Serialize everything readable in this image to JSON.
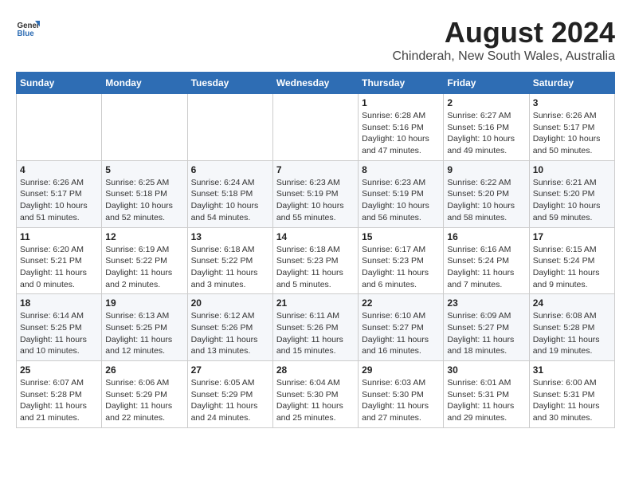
{
  "header": {
    "logo_general": "General",
    "logo_blue": "Blue",
    "title": "August 2024",
    "subtitle": "Chinderah, New South Wales, Australia"
  },
  "calendar": {
    "columns": [
      "Sunday",
      "Monday",
      "Tuesday",
      "Wednesday",
      "Thursday",
      "Friday",
      "Saturday"
    ],
    "weeks": [
      [
        {
          "day": "",
          "info": ""
        },
        {
          "day": "",
          "info": ""
        },
        {
          "day": "",
          "info": ""
        },
        {
          "day": "",
          "info": ""
        },
        {
          "day": "1",
          "info": "Sunrise: 6:28 AM\nSunset: 5:16 PM\nDaylight: 10 hours and 47 minutes."
        },
        {
          "day": "2",
          "info": "Sunrise: 6:27 AM\nSunset: 5:16 PM\nDaylight: 10 hours and 49 minutes."
        },
        {
          "day": "3",
          "info": "Sunrise: 6:26 AM\nSunset: 5:17 PM\nDaylight: 10 hours and 50 minutes."
        }
      ],
      [
        {
          "day": "4",
          "info": "Sunrise: 6:26 AM\nSunset: 5:17 PM\nDaylight: 10 hours and 51 minutes."
        },
        {
          "day": "5",
          "info": "Sunrise: 6:25 AM\nSunset: 5:18 PM\nDaylight: 10 hours and 52 minutes."
        },
        {
          "day": "6",
          "info": "Sunrise: 6:24 AM\nSunset: 5:18 PM\nDaylight: 10 hours and 54 minutes."
        },
        {
          "day": "7",
          "info": "Sunrise: 6:23 AM\nSunset: 5:19 PM\nDaylight: 10 hours and 55 minutes."
        },
        {
          "day": "8",
          "info": "Sunrise: 6:23 AM\nSunset: 5:19 PM\nDaylight: 10 hours and 56 minutes."
        },
        {
          "day": "9",
          "info": "Sunrise: 6:22 AM\nSunset: 5:20 PM\nDaylight: 10 hours and 58 minutes."
        },
        {
          "day": "10",
          "info": "Sunrise: 6:21 AM\nSunset: 5:20 PM\nDaylight: 10 hours and 59 minutes."
        }
      ],
      [
        {
          "day": "11",
          "info": "Sunrise: 6:20 AM\nSunset: 5:21 PM\nDaylight: 11 hours and 0 minutes."
        },
        {
          "day": "12",
          "info": "Sunrise: 6:19 AM\nSunset: 5:22 PM\nDaylight: 11 hours and 2 minutes."
        },
        {
          "day": "13",
          "info": "Sunrise: 6:18 AM\nSunset: 5:22 PM\nDaylight: 11 hours and 3 minutes."
        },
        {
          "day": "14",
          "info": "Sunrise: 6:18 AM\nSunset: 5:23 PM\nDaylight: 11 hours and 5 minutes."
        },
        {
          "day": "15",
          "info": "Sunrise: 6:17 AM\nSunset: 5:23 PM\nDaylight: 11 hours and 6 minutes."
        },
        {
          "day": "16",
          "info": "Sunrise: 6:16 AM\nSunset: 5:24 PM\nDaylight: 11 hours and 7 minutes."
        },
        {
          "day": "17",
          "info": "Sunrise: 6:15 AM\nSunset: 5:24 PM\nDaylight: 11 hours and 9 minutes."
        }
      ],
      [
        {
          "day": "18",
          "info": "Sunrise: 6:14 AM\nSunset: 5:25 PM\nDaylight: 11 hours and 10 minutes."
        },
        {
          "day": "19",
          "info": "Sunrise: 6:13 AM\nSunset: 5:25 PM\nDaylight: 11 hours and 12 minutes."
        },
        {
          "day": "20",
          "info": "Sunrise: 6:12 AM\nSunset: 5:26 PM\nDaylight: 11 hours and 13 minutes."
        },
        {
          "day": "21",
          "info": "Sunrise: 6:11 AM\nSunset: 5:26 PM\nDaylight: 11 hours and 15 minutes."
        },
        {
          "day": "22",
          "info": "Sunrise: 6:10 AM\nSunset: 5:27 PM\nDaylight: 11 hours and 16 minutes."
        },
        {
          "day": "23",
          "info": "Sunrise: 6:09 AM\nSunset: 5:27 PM\nDaylight: 11 hours and 18 minutes."
        },
        {
          "day": "24",
          "info": "Sunrise: 6:08 AM\nSunset: 5:28 PM\nDaylight: 11 hours and 19 minutes."
        }
      ],
      [
        {
          "day": "25",
          "info": "Sunrise: 6:07 AM\nSunset: 5:28 PM\nDaylight: 11 hours and 21 minutes."
        },
        {
          "day": "26",
          "info": "Sunrise: 6:06 AM\nSunset: 5:29 PM\nDaylight: 11 hours and 22 minutes."
        },
        {
          "day": "27",
          "info": "Sunrise: 6:05 AM\nSunset: 5:29 PM\nDaylight: 11 hours and 24 minutes."
        },
        {
          "day": "28",
          "info": "Sunrise: 6:04 AM\nSunset: 5:30 PM\nDaylight: 11 hours and 25 minutes."
        },
        {
          "day": "29",
          "info": "Sunrise: 6:03 AM\nSunset: 5:30 PM\nDaylight: 11 hours and 27 minutes."
        },
        {
          "day": "30",
          "info": "Sunrise: 6:01 AM\nSunset: 5:31 PM\nDaylight: 11 hours and 29 minutes."
        },
        {
          "day": "31",
          "info": "Sunrise: 6:00 AM\nSunset: 5:31 PM\nDaylight: 11 hours and 30 minutes."
        }
      ]
    ]
  }
}
